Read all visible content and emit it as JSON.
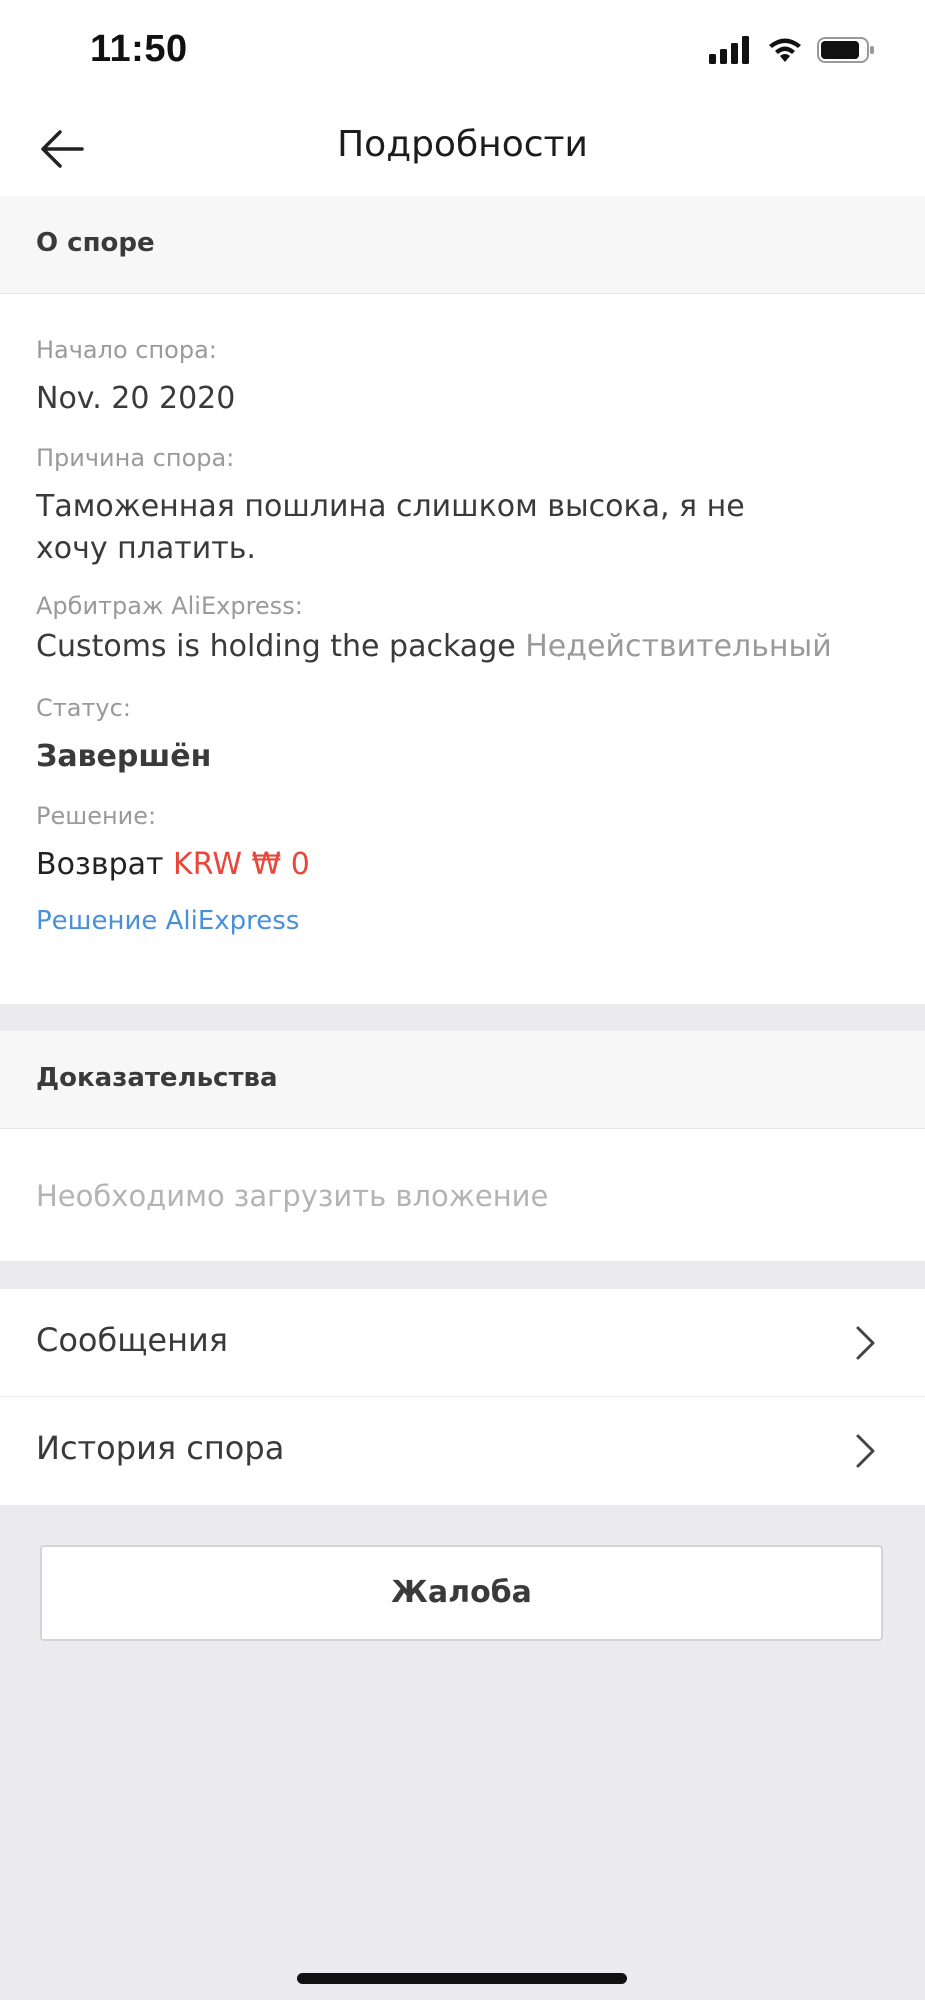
{
  "status_bar": {
    "time": "11:50"
  },
  "nav": {
    "title": "Подробности"
  },
  "dispute": {
    "header": "О споре",
    "start_label": "Начало спора:",
    "start_value": "Nov. 20 2020",
    "reason_label": "Причина спора:",
    "reason_line1": "Таможенная пошлина слишком высока, я не",
    "reason_line2": "хочу платить.",
    "arbitration_label": "Арбитраж AliExpress:",
    "arbitration_value": "Customs is holding the package",
    "arbitration_status": "Недействительный",
    "status_label": "Статус:",
    "status_value": "Завершён",
    "solution_label": "Решение:",
    "refund_word": "Возврат",
    "refund_amount": "KRW ₩ 0",
    "solution_link": "Решение AliExpress"
  },
  "evidence": {
    "header": "Доказательства",
    "placeholder": "Необходимо загрузить вложение"
  },
  "menu": {
    "messages": "Сообщения",
    "history": "История спора"
  },
  "complaint_button": "Жалоба",
  "colors": {
    "accent_red": "#e8473a",
    "link_blue": "#4a90d9",
    "background": "#ebebed"
  }
}
